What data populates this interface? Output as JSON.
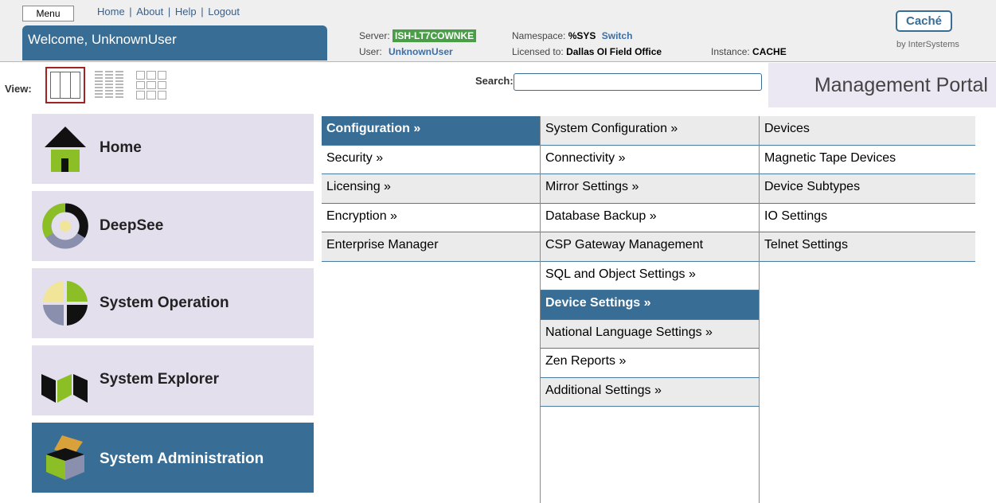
{
  "header": {
    "menu_label": "Menu",
    "links": [
      "Home",
      "About",
      "Help",
      "Logout"
    ],
    "welcome": "Welcome, UnknownUser",
    "server_label": "Server:",
    "server_value": "ISH-LT7COWNKE",
    "namespace_label": "Namespace:",
    "namespace_value": "%SYS",
    "switch_label": "Switch",
    "user_label": "User:",
    "user_value": "UnknownUser",
    "licensed_label": "Licensed to:",
    "licensed_value": "Dallas OI Field Office",
    "instance_label": "Instance:",
    "instance_value": "CACHE",
    "logo_text": "Caché",
    "logo_by": "by InterSystems"
  },
  "toolbar": {
    "view_label": "View:",
    "search_label": "Search:",
    "search_value": "",
    "portal_title": "Management Portal"
  },
  "nav": [
    {
      "label": "Home",
      "icon": "home-icon"
    },
    {
      "label": "DeepSee",
      "icon": "deepsee-icon"
    },
    {
      "label": "System Operation",
      "icon": "system-operation-icon"
    },
    {
      "label": "System Explorer",
      "icon": "system-explorer-icon"
    },
    {
      "label": "System Administration",
      "icon": "system-administration-icon",
      "active": true
    }
  ],
  "menu_col1": [
    "Configuration »",
    "Security »",
    "Licensing »",
    "Encryption »",
    "Enterprise Manager"
  ],
  "menu_col2": [
    "System Configuration »",
    "Connectivity »",
    "Mirror Settings »",
    "Database Backup »",
    "CSP Gateway Management",
    "SQL and Object Settings »",
    "Device Settings »",
    "National Language Settings »",
    "Zen Reports »",
    "Additional Settings »"
  ],
  "menu_col3": [
    "Devices",
    "Magnetic Tape Devices",
    "Device Subtypes",
    "IO Settings",
    "Telnet Settings"
  ],
  "colors": {
    "accent": "#386d95",
    "server_badge": "#4b9e48",
    "nav_bg": "#e3dfed",
    "active_view_border": "#a02323"
  }
}
